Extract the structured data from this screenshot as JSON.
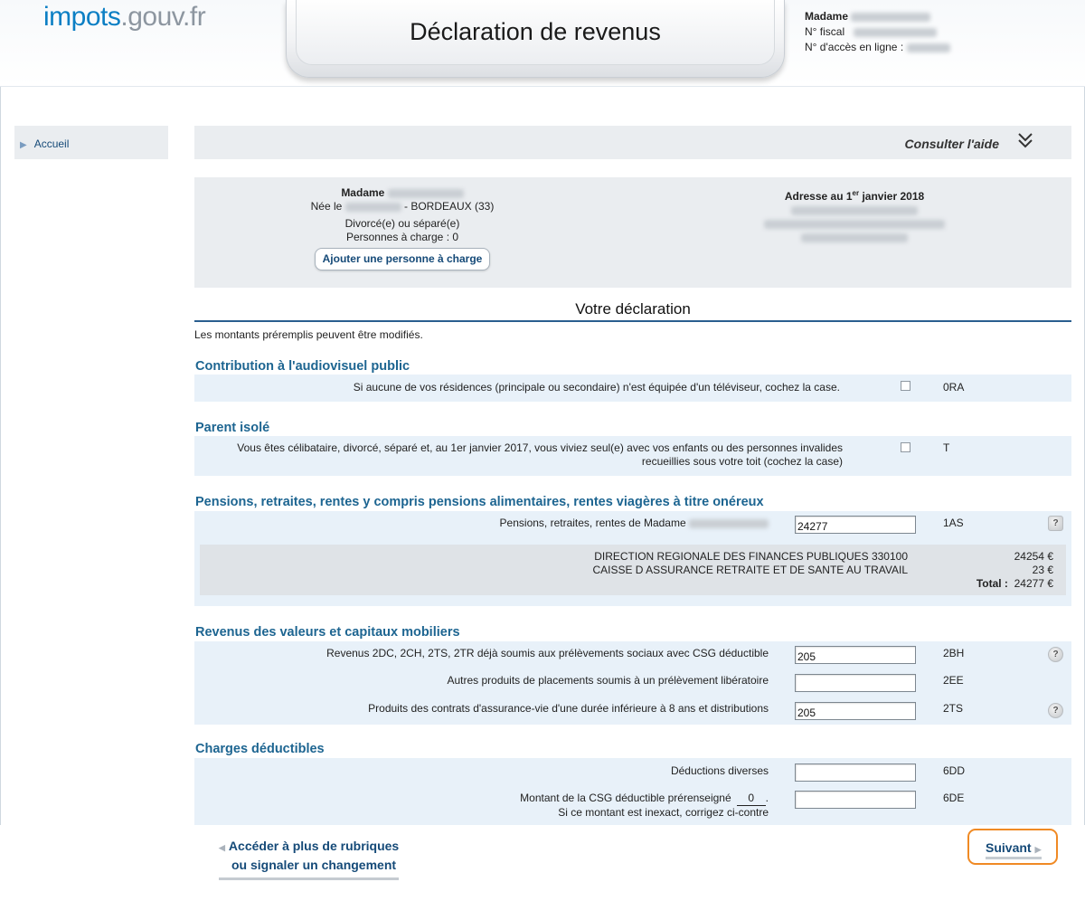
{
  "header": {
    "logo_part1": "impots",
    "logo_part2": ".gouv.fr",
    "title": "Déclaration de revenus",
    "user_title": "Madame",
    "fiscal_label": "N° fiscal",
    "access_label": "N° d'accès en ligne :"
  },
  "sidebar": {
    "home": "Accueil"
  },
  "help": {
    "label": "Consulter l'aide"
  },
  "identity": {
    "civility": "Madame",
    "born_prefix": "Née le",
    "born_suffix": "- BORDEAUX (33)",
    "status": "Divorcé(e) ou séparé(e)",
    "dependents": "Personnes à charge : 0",
    "add_dependent": "Ajouter une personne à charge",
    "address_title_pre": "Adresse au 1",
    "address_title_sup": "er",
    "address_title_post": " janvier 2018"
  },
  "declaration": {
    "title": "Votre déclaration",
    "note": "Les montants préremplis peuvent être modifiés."
  },
  "sections": {
    "audiovisuel": {
      "title": "Contribution à l'audiovisuel public",
      "label": "Si aucune de vos résidences (principale ou secondaire) n'est équipée d'un téléviseur, cochez la case.",
      "code": "0RA"
    },
    "parent": {
      "title": "Parent isolé",
      "label_line1": "Vous êtes célibataire, divorcé, séparé et, au 1er janvier 2017, vous viviez seul(e) avec vos enfants ou des personnes invalides",
      "label_line2": "recueillies sous votre toit (cochez la case)",
      "code": "T"
    },
    "pensions": {
      "title": "Pensions, retraites, rentes y compris pensions alimentaires, rentes viagères à titre onéreux",
      "label": "Pensions, retraites, rentes de Madame",
      "value": "24277",
      "code": "1AS",
      "payer1": "DIRECTION REGIONALE DES FINANCES PUBLIQUES 330100",
      "payer2": "CAISSE D ASSURANCE RETRAITE ET DE SANTE AU TRAVAIL",
      "amount1": "24254 €",
      "amount2": "23 €",
      "total_label": "Total :",
      "total": "24277 €"
    },
    "capitaux": {
      "title": "Revenus des valeurs et capitaux mobiliers",
      "row1_label": "Revenus 2DC, 2CH, 2TS, 2TR déjà soumis aux prélèvements sociaux avec CSG déductible",
      "row1_value": "205",
      "row1_code": "2BH",
      "row2_label": "Autres produits de placements soumis à un prélèvement libératoire",
      "row2_value": "",
      "row2_code": "2EE",
      "row3_label": "Produits des contrats d'assurance-vie d'une durée inférieure à 8 ans et distributions",
      "row3_value": "205",
      "row3_code": "2TS"
    },
    "charges": {
      "title": "Charges déductibles",
      "row1_label": "Déductions diverses",
      "row1_value": "",
      "row1_code": "6DD",
      "row2_label": "Montant de la CSG déductible prérenseigné",
      "row2_prefilled": "0",
      "row2_hint": "Si ce montant est inexact, corrigez ci-contre",
      "row2_value": "",
      "row2_code": "6DE"
    }
  },
  "footer": {
    "more_line1": "Accéder à plus de rubriques",
    "more_line2": "ou signaler un changement",
    "next": "Suivant"
  },
  "colors": {
    "accent_orange": "#f08a24",
    "section_blue": "#1d6591",
    "logo_blue": "#0c7fc4"
  }
}
